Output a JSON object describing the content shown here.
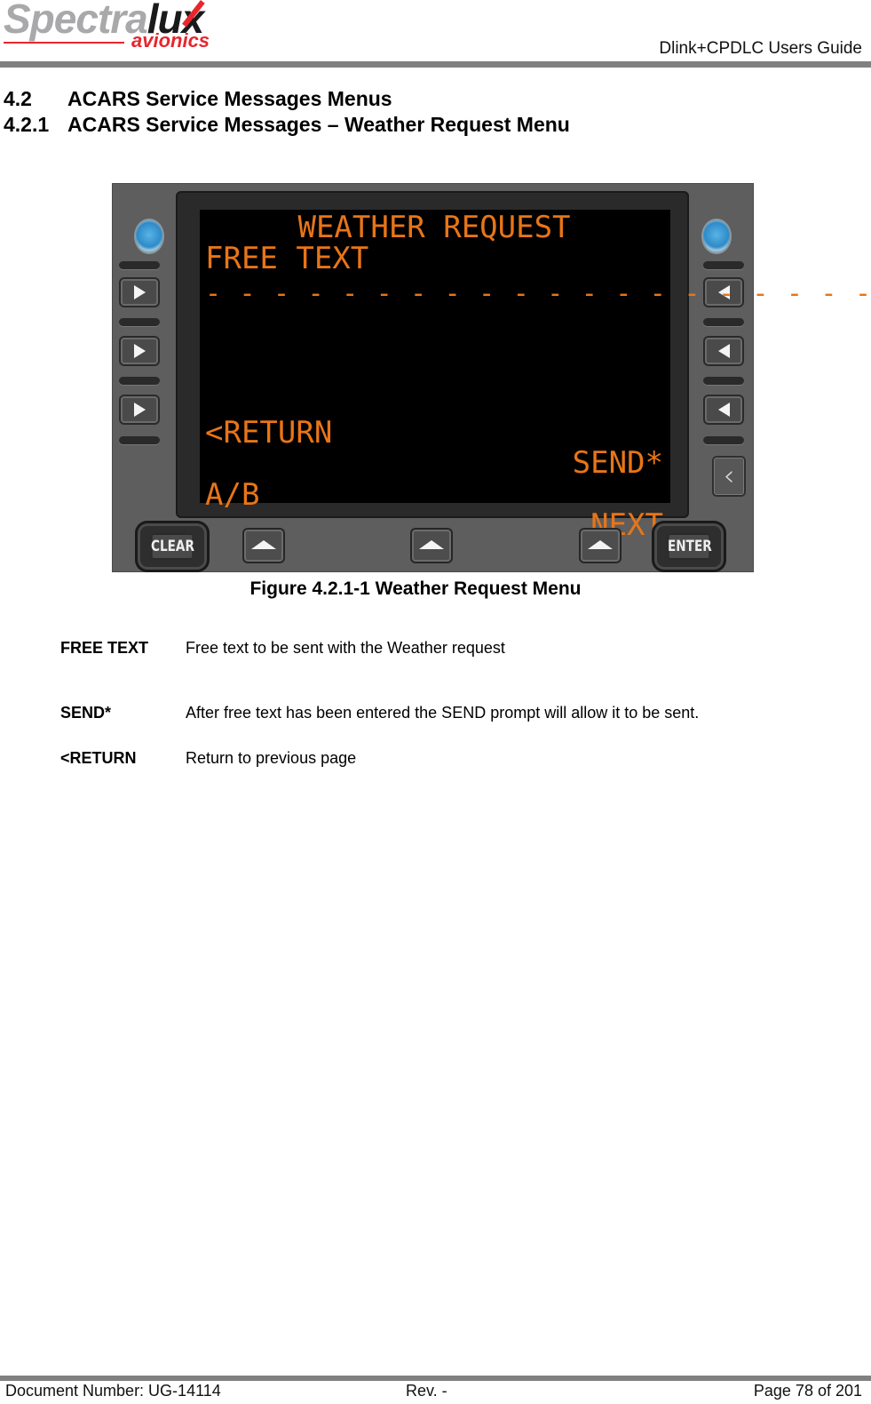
{
  "header": {
    "logo": {
      "brand_part1": "Spectra",
      "brand_part2": "lux",
      "tagline": "avionics"
    },
    "title": "Dlink+CPDLC Users Guide"
  },
  "headings": {
    "section": {
      "number": "4.2",
      "title": "ACARS Service Messages Menus"
    },
    "subsection": {
      "number": "4.2.1",
      "title": "ACARS Service Messages – Weather Request Menu"
    }
  },
  "figure": {
    "screen": {
      "title": "WEATHER REQUEST",
      "line1": "FREE TEXT",
      "line2": "------------------------",
      "l4_left": "<RETURN",
      "l4_right": "SEND*",
      "l6_left": "A/B",
      "l6_right": "NEXT"
    },
    "buttons": {
      "clear": "CLEAR",
      "enter": "ENTER"
    },
    "colors": {
      "screen_text": "#e87517",
      "screen_bg": "#000000",
      "bezel": "#5e5e5e"
    },
    "caption": "Figure 4.2.1-1 Weather Request Menu"
  },
  "definitions": [
    {
      "term": "FREE TEXT",
      "description": "Free text to be sent with the Weather request"
    },
    {
      "term": "SEND*",
      "description": "After free text has been entered the SEND prompt will allow it to be sent."
    },
    {
      "term": "<RETURN",
      "description": "Return to previous page"
    }
  ],
  "footer": {
    "document_number": "Document Number:  UG-14114",
    "revision": "Rev. -",
    "page": "Page 78 of 201"
  }
}
